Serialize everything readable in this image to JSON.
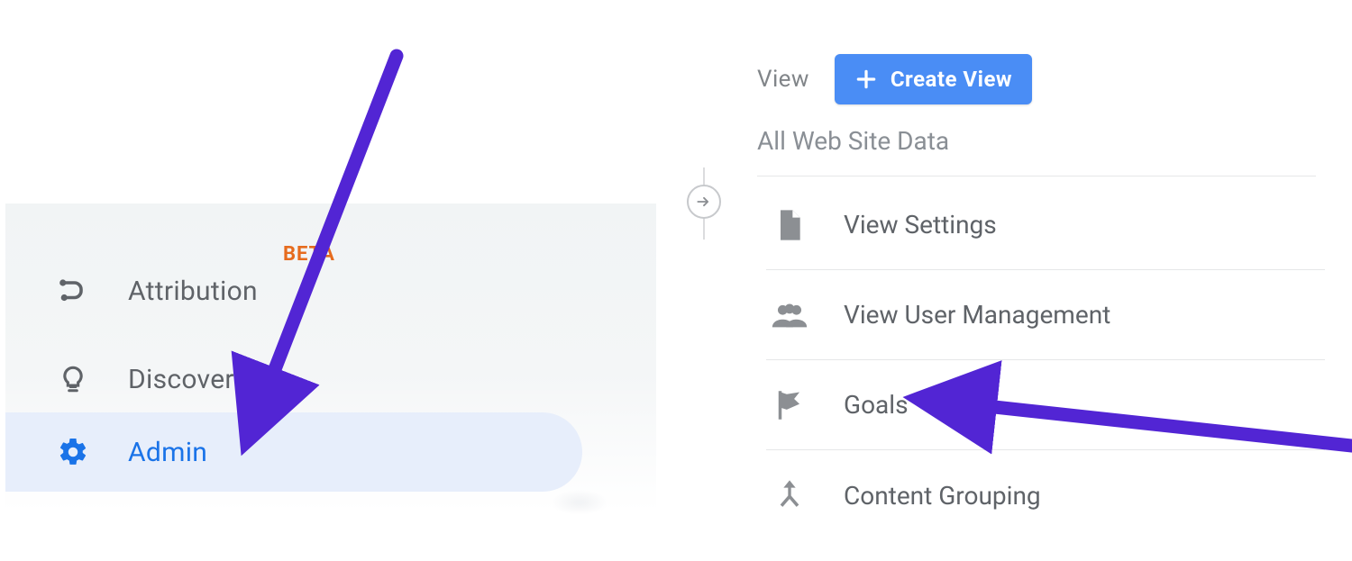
{
  "left_nav": {
    "items": [
      {
        "label": "Attribution",
        "badge": "BETA"
      },
      {
        "label": "Discover"
      },
      {
        "label": "Admin"
      }
    ]
  },
  "right_panel": {
    "column_label": "View",
    "create_button": "Create View",
    "subtitle": "All Web Site Data",
    "items": [
      {
        "label": "View Settings"
      },
      {
        "label": "View User Management"
      },
      {
        "label": "Goals"
      },
      {
        "label": "Content Grouping"
      }
    ]
  }
}
